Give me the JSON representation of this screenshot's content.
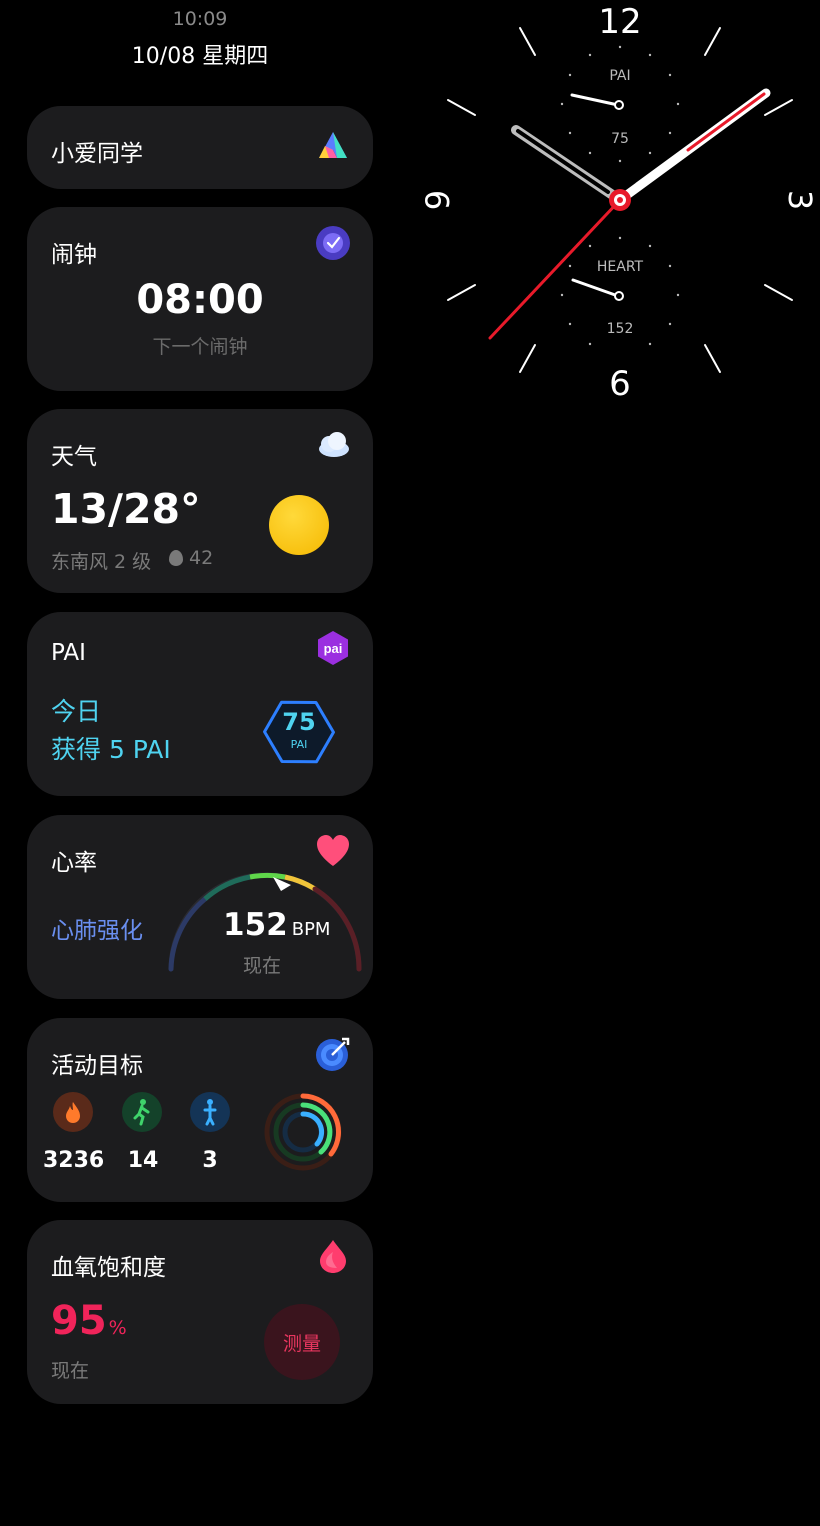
{
  "status": {
    "time": "10:09",
    "date": "10/08 星期四"
  },
  "xiaoai": {
    "title": "小爱同学",
    "icon": "xiaoai-logo-icon"
  },
  "alarm": {
    "title": "闹钟",
    "time": "08:00",
    "subtitle": "下一个闹钟",
    "icon": "alarm-clock-icon"
  },
  "weather": {
    "title": "天气",
    "temp": "13/28°",
    "wind": "东南风 2 级",
    "aqi": "42",
    "icon": "cloud-icon"
  },
  "pai": {
    "title": "PAI",
    "line1": "今日",
    "line2": "获得 5 PAI",
    "value": "75",
    "unit": "PAI",
    "icon": "pai-icon"
  },
  "heart": {
    "title": "心率",
    "zone": "心肺强化",
    "value": "152",
    "unit": "BPM",
    "now": "现在",
    "icon": "heart-icon"
  },
  "activity": {
    "title": "活动目标",
    "icon": "target-icon",
    "items": [
      {
        "icon": "flame-icon",
        "value": "3236",
        "color": "#ff7a2b"
      },
      {
        "icon": "walking-icon",
        "value": "14",
        "color": "#3fd46b"
      },
      {
        "icon": "standing-icon",
        "value": "3",
        "color": "#3ab0ff"
      }
    ]
  },
  "spo2": {
    "title": "血氧饱和度",
    "value": "95",
    "unit": "%",
    "now": "现在",
    "button": "测量",
    "icon": "blood-drop-icon"
  },
  "watch": {
    "numerals": {
      "n12": "12",
      "n3": "3",
      "n6": "6",
      "n9": "9"
    },
    "top_label": "PAI",
    "top_value": "75",
    "bottom_label": "HEART",
    "bottom_value": "152"
  },
  "colors": {
    "accent_red": "#e81a2a",
    "pai_cyan": "#4fd3f0",
    "heart_blue": "#6a8ff0",
    "spo2_red": "#f0245a"
  }
}
